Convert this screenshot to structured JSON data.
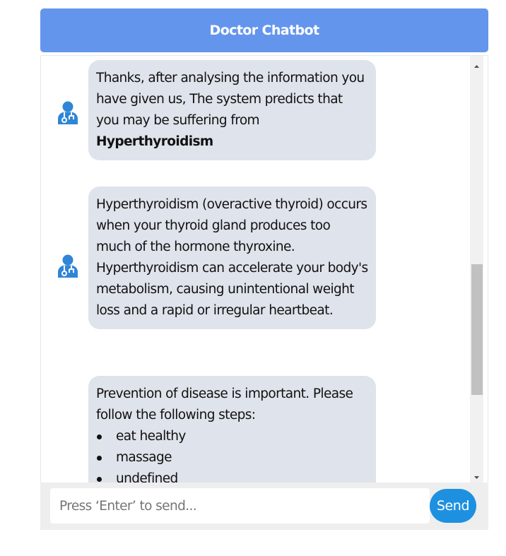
{
  "header": {
    "title": "Doctor Chatbot"
  },
  "messages": [
    {
      "sender": "bot",
      "avatar_icon": "doctor-icon",
      "text_before": "Thanks, after analysing the information you have given us, The system predicts that you may be suffering from ",
      "text_bold": "Hyperthyroidism"
    },
    {
      "sender": "bot",
      "avatar_icon": "doctor-icon",
      "text": "Hyperthyroidism (overactive thyroid) occurs when your thyroid gland produces too much of the hormone thyroxine. Hyperthyroidism can accelerate your body's metabolism, causing unintentional weight loss and a rapid or irregular heartbeat."
    },
    {
      "sender": "bot",
      "avatar_icon": "doctor-icon",
      "text": "Prevention of disease is important. Please follow the following steps:",
      "steps": [
        "eat healthy",
        "massage",
        "undefined"
      ]
    }
  ],
  "input": {
    "placeholder": "Press ‘Enter’ to send...",
    "value": ""
  },
  "send_button": {
    "label": "Send"
  },
  "colors": {
    "header_bg": "#6495ed",
    "bubble_bg": "#dfe3eb",
    "send_bg": "#1e90e0",
    "avatar": "#2f86d6"
  }
}
